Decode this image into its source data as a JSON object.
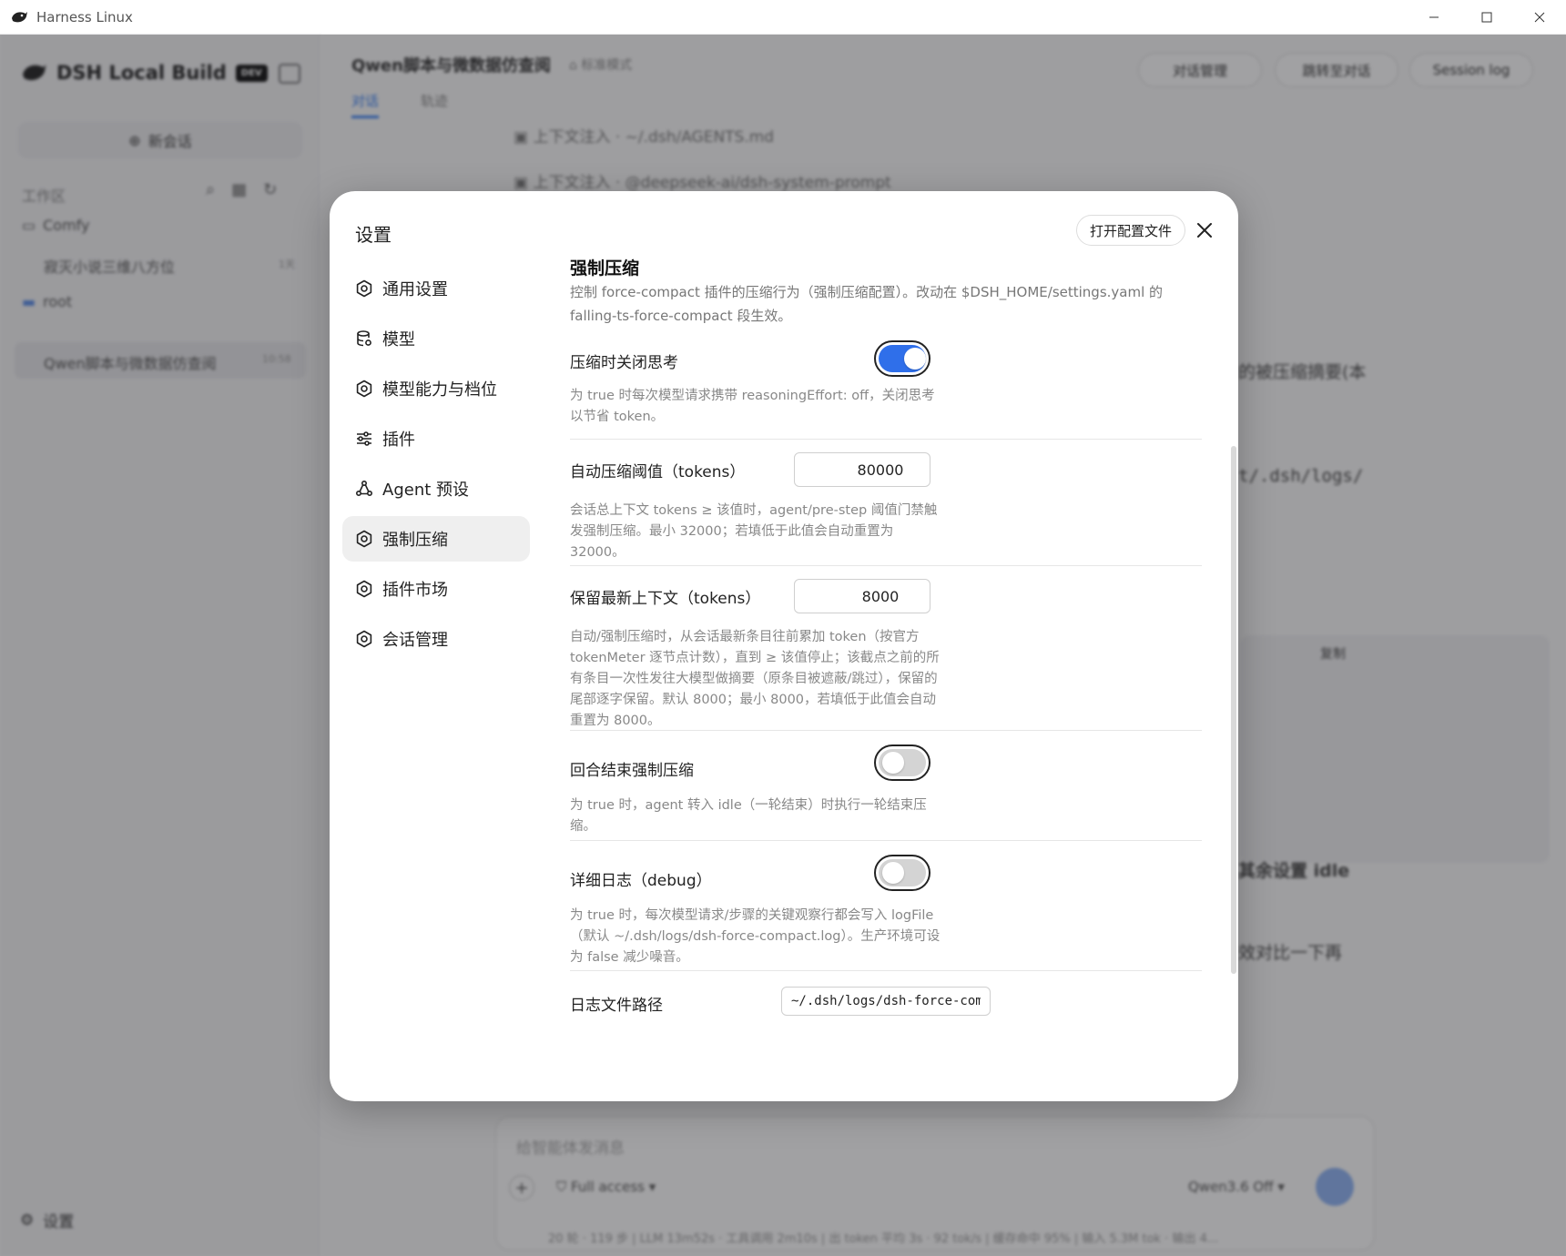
{
  "window": {
    "title": "Harness Linux"
  },
  "sidebar": {
    "brand": "DSH Local Build",
    "badge": "DEV",
    "new_chat": "新会话",
    "workspace_label": "工作区",
    "tree": [
      {
        "label": "Comfy",
        "type": "folder"
      },
      {
        "label": "寂灭小说三维八方位",
        "count": "1天",
        "type": "session"
      },
      {
        "label": "root",
        "type": "folder"
      },
      {
        "label": "Qwen脚本与微数据仿查阅",
        "count": "10:58",
        "type": "session",
        "active": true
      }
    ],
    "settings": "设置"
  },
  "main": {
    "header_title": "Qwen脚本与微数据仿查阅",
    "mode": "标准模式",
    "tabs": [
      "对话",
      "轨迹"
    ],
    "buttons": [
      "对话管理",
      "跳转至对话",
      "Session log"
    ],
    "context_lines": [
      "上下文注入 · ~/.dsh/AGENTS.md",
      "上下文注入 · @deepseek-ai/dsh-system-prompt"
    ],
    "fragments": [
      "的被压缩摘要(本",
      "t/.dsh/logs/",
      "复制",
      "其余设置 idle",
      "效对比一下再"
    ],
    "composer": {
      "placeholder": "给智能体发消息",
      "access": "Full access",
      "model": "Qwen3.6 Off"
    },
    "statusbar": "20 轮 · 119 步 | LLM 13m52s · 工具调用 2m10s | 出 token 平均 3s · 92 tok/s | 缓存命中 95% | 输入 5.3M tok · 输出 4..."
  },
  "modal": {
    "title": "设置",
    "open_config": "打开配置文件",
    "nav": [
      {
        "label": "通用设置",
        "icon": "gear-icon"
      },
      {
        "label": "模型",
        "icon": "database-icon"
      },
      {
        "label": "模型能力与档位",
        "icon": "gear-icon"
      },
      {
        "label": "插件",
        "icon": "sliders-icon"
      },
      {
        "label": "Agent 预设",
        "icon": "agent-icon"
      },
      {
        "label": "强制压缩",
        "icon": "gear-icon",
        "active": true
      },
      {
        "label": "插件市场",
        "icon": "gear-icon"
      },
      {
        "label": "会话管理",
        "icon": "gear-icon"
      }
    ],
    "section": {
      "title": "强制压缩",
      "description": "控制 force-compact 插件的压缩行为（强制压缩配置）。改动在 $DSH_HOME/settings.yaml 的 falling-ts-force-compact 段生效。"
    },
    "settings": {
      "disable_thinking": {
        "label": "压缩时关闭思考",
        "value": true,
        "help": "为 true 时每次模型请求携带 reasoningEffort: off，关闭思考以节省 token。"
      },
      "auto_threshold": {
        "label": "自动压缩阈值（tokens）",
        "value": "80000",
        "help": "会话总上下文 tokens ≥ 该值时，agent/pre-step 阈值门禁触发强制压缩。最小 32000；若填低于此值会自动重置为 32000。"
      },
      "keep_recent": {
        "label": "保留最新上下文（tokens）",
        "value": "8000",
        "help": "自动/强制压缩时，从会话最新条目往前累加 token（按官方 tokenMeter 逐节点计数），直到 ≥ 该值停止；该截点之前的所有条目一次性发往大模型做摘要（原条目被遮蔽/跳过），保留的尾部逐字保留。默认 8000；最小 8000，若填低于此值会自动重置为 8000。"
      },
      "turn_end": {
        "label": "回合结束强制压缩",
        "value": false,
        "help": "为 true 时，agent 转入 idle（一轮结束）时执行一轮结束压缩。"
      },
      "debug": {
        "label": "详细日志（debug）",
        "value": false,
        "help": "为 true 时，每次模型请求/步骤的关键观察行都会写入 logFile（默认 ~/.dsh/logs/dsh-force-compact.log）。生产环境可设为 false 减少噪音。"
      },
      "log_path": {
        "label": "日志文件路径",
        "value": "~/.dsh/logs/dsh-force-compac"
      }
    }
  }
}
